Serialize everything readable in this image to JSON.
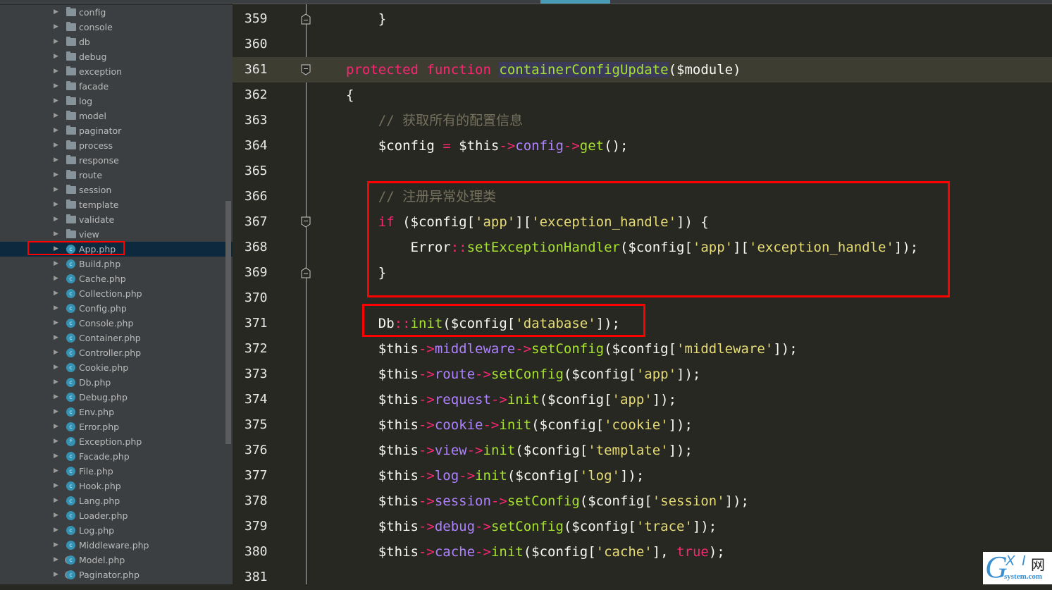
{
  "sidebar": {
    "items": [
      {
        "type": "folder",
        "label": "config"
      },
      {
        "type": "folder",
        "label": "console"
      },
      {
        "type": "folder",
        "label": "db"
      },
      {
        "type": "folder",
        "label": "debug"
      },
      {
        "type": "folder",
        "label": "exception"
      },
      {
        "type": "folder",
        "label": "facade"
      },
      {
        "type": "folder",
        "label": "log"
      },
      {
        "type": "folder",
        "label": "model"
      },
      {
        "type": "folder",
        "label": "paginator"
      },
      {
        "type": "folder",
        "label": "process"
      },
      {
        "type": "folder",
        "label": "response"
      },
      {
        "type": "folder",
        "label": "route"
      },
      {
        "type": "folder",
        "label": "session"
      },
      {
        "type": "folder",
        "label": "template"
      },
      {
        "type": "folder",
        "label": "validate"
      },
      {
        "type": "folder",
        "label": "view"
      },
      {
        "type": "class",
        "label": "App.php",
        "selected": true
      },
      {
        "type": "class",
        "label": "Build.php"
      },
      {
        "type": "class",
        "label": "Cache.php"
      },
      {
        "type": "class",
        "label": "Collection.php"
      },
      {
        "type": "class",
        "label": "Config.php"
      },
      {
        "type": "class",
        "label": "Console.php"
      },
      {
        "type": "class",
        "label": "Container.php"
      },
      {
        "type": "class",
        "label": "Controller.php"
      },
      {
        "type": "class",
        "label": "Cookie.php"
      },
      {
        "type": "class",
        "label": "Db.php"
      },
      {
        "type": "class",
        "label": "Debug.php"
      },
      {
        "type": "class",
        "label": "Env.php"
      },
      {
        "type": "class",
        "label": "Error.php"
      },
      {
        "type": "exception",
        "label": "Exception.php"
      },
      {
        "type": "class",
        "label": "Facade.php"
      },
      {
        "type": "class",
        "label": "File.php"
      },
      {
        "type": "class",
        "label": "Hook.php"
      },
      {
        "type": "class",
        "label": "Lang.php"
      },
      {
        "type": "class",
        "label": "Loader.php"
      },
      {
        "type": "class",
        "label": "Log.php"
      },
      {
        "type": "class",
        "label": "Middleware.php"
      },
      {
        "type": "abstract",
        "label": "Model.php"
      },
      {
        "type": "abstract",
        "label": "Paginator.php"
      }
    ],
    "icon_glyphs": {
      "class": "c",
      "exception": "⚡",
      "abstract": "c",
      "expand_arrow": "▶"
    }
  },
  "editor": {
    "current_line": 361,
    "lines": [
      {
        "n": "359",
        "fold": "end",
        "tokens": [
          [
            "    }",
            "var"
          ]
        ]
      },
      {
        "n": "360",
        "tokens": []
      },
      {
        "n": "361",
        "fold": "start",
        "current": true,
        "tokens": [
          [
            "protected",
            "kw"
          ],
          [
            " ",
            "var"
          ],
          [
            "function",
            "kw"
          ],
          [
            " ",
            "var"
          ],
          [
            "containerConfigUpdate",
            "fnhl"
          ],
          [
            "($module)",
            "var"
          ]
        ]
      },
      {
        "n": "362",
        "tokens": [
          [
            "{",
            "var"
          ]
        ]
      },
      {
        "n": "363",
        "tokens": [
          [
            "    // 获取所有的配置信息",
            "cm"
          ]
        ]
      },
      {
        "n": "364",
        "tokens": [
          [
            "    $config ",
            "var"
          ],
          [
            "=",
            "op"
          ],
          [
            " $this",
            "var"
          ],
          [
            "->",
            "op"
          ],
          [
            "config",
            "prop"
          ],
          [
            "->",
            "op"
          ],
          [
            "get",
            "fn"
          ],
          [
            "();",
            "var"
          ]
        ]
      },
      {
        "n": "365",
        "tokens": []
      },
      {
        "n": "366",
        "tokens": [
          [
            "    // 注册异常处理类",
            "cm"
          ]
        ]
      },
      {
        "n": "367",
        "fold": "start",
        "tokens": [
          [
            "    ",
            "var"
          ],
          [
            "if",
            "kw"
          ],
          [
            " ($config[",
            "var"
          ],
          [
            "'app'",
            "str"
          ],
          [
            "][",
            "var"
          ],
          [
            "'exception_handle'",
            "str"
          ],
          [
            "]) {",
            "var"
          ]
        ]
      },
      {
        "n": "368",
        "tokens": [
          [
            "        Error",
            "var"
          ],
          [
            "::",
            "op"
          ],
          [
            "setExceptionHandler",
            "fn"
          ],
          [
            "($config[",
            "var"
          ],
          [
            "'app'",
            "str"
          ],
          [
            "][",
            "var"
          ],
          [
            "'exception_handle'",
            "str"
          ],
          [
            "]);",
            "var"
          ]
        ]
      },
      {
        "n": "369",
        "fold": "end",
        "tokens": [
          [
            "    }",
            "var"
          ]
        ]
      },
      {
        "n": "370",
        "tokens": []
      },
      {
        "n": "371",
        "tokens": [
          [
            "    Db",
            "var"
          ],
          [
            "::",
            "op"
          ],
          [
            "init",
            "fn"
          ],
          [
            "($config[",
            "var"
          ],
          [
            "'database'",
            "str"
          ],
          [
            "]);",
            "var"
          ]
        ]
      },
      {
        "n": "372",
        "tokens": [
          [
            "    $this",
            "var"
          ],
          [
            "->",
            "op"
          ],
          [
            "middleware",
            "prop"
          ],
          [
            "->",
            "op"
          ],
          [
            "setConfig",
            "fn"
          ],
          [
            "($config[",
            "var"
          ],
          [
            "'middleware'",
            "str"
          ],
          [
            "]);",
            "var"
          ]
        ]
      },
      {
        "n": "373",
        "tokens": [
          [
            "    $this",
            "var"
          ],
          [
            "->",
            "op"
          ],
          [
            "route",
            "prop"
          ],
          [
            "->",
            "op"
          ],
          [
            "setConfig",
            "fn"
          ],
          [
            "($config[",
            "var"
          ],
          [
            "'app'",
            "str"
          ],
          [
            "]);",
            "var"
          ]
        ]
      },
      {
        "n": "374",
        "tokens": [
          [
            "    $this",
            "var"
          ],
          [
            "->",
            "op"
          ],
          [
            "request",
            "prop"
          ],
          [
            "->",
            "op"
          ],
          [
            "init",
            "fn"
          ],
          [
            "($config[",
            "var"
          ],
          [
            "'app'",
            "str"
          ],
          [
            "]);",
            "var"
          ]
        ]
      },
      {
        "n": "375",
        "tokens": [
          [
            "    $this",
            "var"
          ],
          [
            "->",
            "op"
          ],
          [
            "cookie",
            "prop"
          ],
          [
            "->",
            "op"
          ],
          [
            "init",
            "fn"
          ],
          [
            "($config[",
            "var"
          ],
          [
            "'cookie'",
            "str"
          ],
          [
            "]);",
            "var"
          ]
        ]
      },
      {
        "n": "376",
        "tokens": [
          [
            "    $this",
            "var"
          ],
          [
            "->",
            "op"
          ],
          [
            "view",
            "prop"
          ],
          [
            "->",
            "op"
          ],
          [
            "init",
            "fn"
          ],
          [
            "($config[",
            "var"
          ],
          [
            "'template'",
            "str"
          ],
          [
            "]);",
            "var"
          ]
        ]
      },
      {
        "n": "377",
        "tokens": [
          [
            "    $this",
            "var"
          ],
          [
            "->",
            "op"
          ],
          [
            "log",
            "prop"
          ],
          [
            "->",
            "op"
          ],
          [
            "init",
            "fn"
          ],
          [
            "($config[",
            "var"
          ],
          [
            "'log'",
            "str"
          ],
          [
            "]);",
            "var"
          ]
        ]
      },
      {
        "n": "378",
        "tokens": [
          [
            "    $this",
            "var"
          ],
          [
            "->",
            "op"
          ],
          [
            "session",
            "prop"
          ],
          [
            "->",
            "op"
          ],
          [
            "setConfig",
            "fn"
          ],
          [
            "($config[",
            "var"
          ],
          [
            "'session'",
            "str"
          ],
          [
            "]);",
            "var"
          ]
        ]
      },
      {
        "n": "379",
        "tokens": [
          [
            "    $this",
            "var"
          ],
          [
            "->",
            "op"
          ],
          [
            "debug",
            "prop"
          ],
          [
            "->",
            "op"
          ],
          [
            "setConfig",
            "fn"
          ],
          [
            "($config[",
            "var"
          ],
          [
            "'trace'",
            "str"
          ],
          [
            "]);",
            "var"
          ]
        ]
      },
      {
        "n": "380",
        "tokens": [
          [
            "    $this",
            "var"
          ],
          [
            "->",
            "op"
          ],
          [
            "cache",
            "prop"
          ],
          [
            "->",
            "op"
          ],
          [
            "init",
            "fn"
          ],
          [
            "($config[",
            "var"
          ],
          [
            "'cache'",
            "str"
          ],
          [
            "], ",
            "var"
          ],
          [
            "true",
            "kw"
          ],
          [
            ");",
            "var"
          ]
        ]
      },
      {
        "n": "381",
        "tokens": []
      }
    ]
  },
  "colors": {
    "keyword": "#f92672",
    "function": "#a6e22e",
    "property": "#ae81ff",
    "string": "#e6db74",
    "comment": "#75715e",
    "annotation": "#ff0000",
    "selection": "#0d293e"
  },
  "watermark": {
    "logo_letter": "G",
    "logo_text": "X I",
    "logo_cn": "网",
    "domain": "system.com"
  }
}
